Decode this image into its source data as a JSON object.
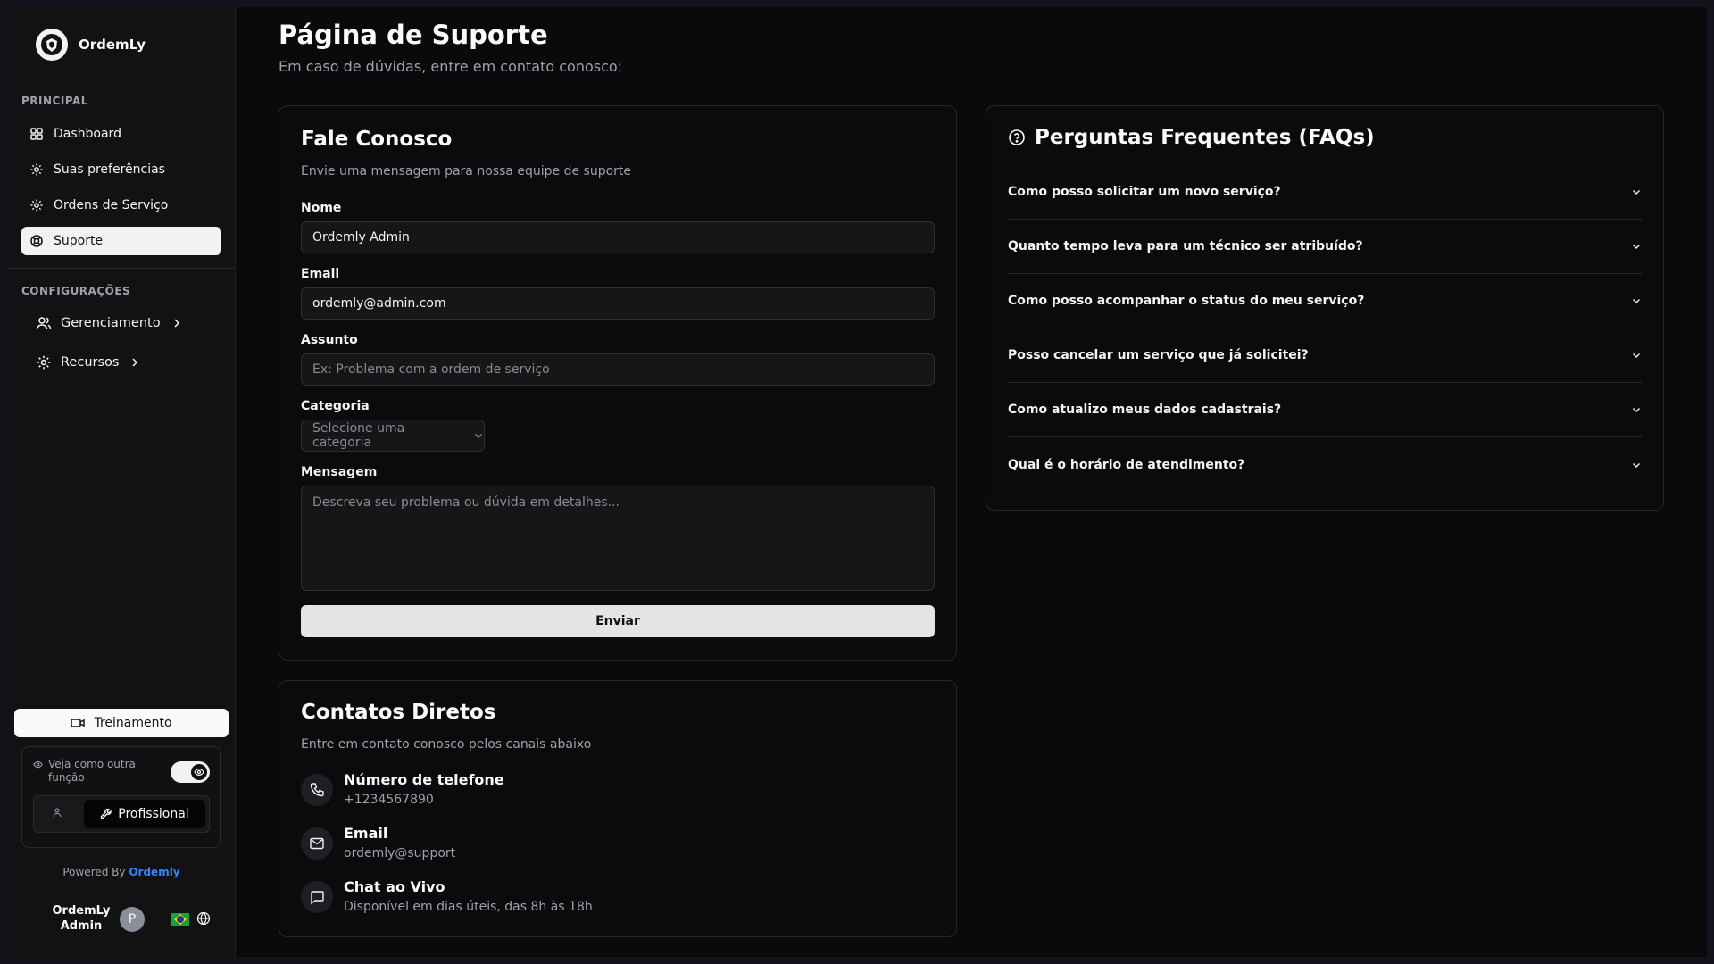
{
  "app": {
    "name": "OrdemLy"
  },
  "sidebar": {
    "principal_label": "PRINCIPAL",
    "config_label": "CONFIGURAÇÕES",
    "items": [
      {
        "label": "Dashboard",
        "icon": "dashboard-icon"
      },
      {
        "label": "Suas preferências",
        "icon": "gear-icon"
      },
      {
        "label": "Ordens de Serviço",
        "icon": "gear-icon"
      },
      {
        "label": "Suporte",
        "icon": "support-icon",
        "active": true
      }
    ],
    "config_items": [
      {
        "label": "Gerenciamento",
        "icon": "users-icon"
      },
      {
        "label": "Recursos",
        "icon": "gear-icon"
      }
    ],
    "training_label": "Treinamento",
    "role_view_label": "Veja como outra função",
    "role_toggle_on": true,
    "role_selected": "Profissional",
    "powered_by": "Powered By",
    "powered_brand": "Ordemly",
    "user": {
      "name": "OrdemLy Admin",
      "avatar_initial": "P"
    }
  },
  "page": {
    "title": "Página de Suporte",
    "subtitle": "Em caso de dúvidas, entre em contato conosco:"
  },
  "contact_form": {
    "title": "Fale Conosco",
    "subtitle": "Envie uma mensagem para nossa equipe de suporte",
    "name_label": "Nome",
    "name_value": "Ordemly Admin",
    "email_label": "Email",
    "email_value": "ordemly@admin.com",
    "subject_label": "Assunto",
    "subject_placeholder": "Ex: Problema com a ordem de serviço",
    "category_label": "Categoria",
    "category_placeholder": "Selecione uma categoria",
    "message_label": "Mensagem",
    "message_placeholder": "Descreva seu problema ou dúvida em detalhes...",
    "submit_label": "Enviar"
  },
  "direct_contacts": {
    "title": "Contatos Diretos",
    "subtitle": "Entre em contato conosco pelos canais abaixo",
    "items": [
      {
        "title": "Número de telefone",
        "value": "+1234567890",
        "icon": "phone-icon"
      },
      {
        "title": "Email",
        "value": "ordemly@support",
        "icon": "mail-icon"
      },
      {
        "title": "Chat ao Vivo",
        "value": "Disponível em dias úteis, das 8h às 18h",
        "icon": "chat-icon"
      }
    ]
  },
  "faq": {
    "title": "Perguntas Frequentes (FAQs)",
    "items": [
      "Como posso solicitar um novo serviço?",
      "Quanto tempo leva para um técnico ser atribuído?",
      "Como posso acompanhar o status do meu serviço?",
      "Posso cancelar um serviço que já solicitei?",
      "Como atualizo meus dados cadastrais?",
      "Qual é o horário de atendimento?"
    ]
  },
  "colors": {
    "background": "#0a0a0c",
    "sidebar": "#121214",
    "accent_link": "#3b82f6",
    "active_item": "#f2f2f3"
  }
}
